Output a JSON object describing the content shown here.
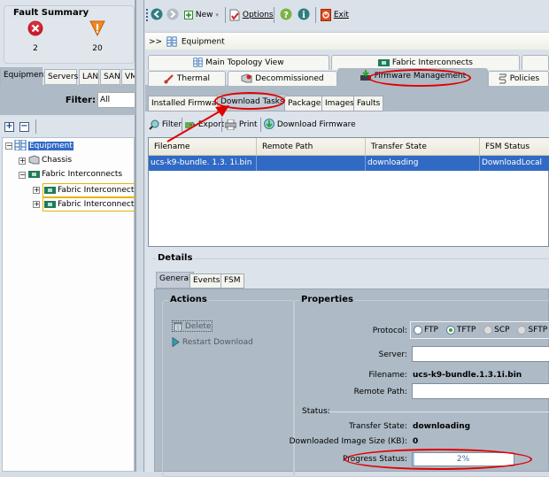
{
  "fault_summary": {
    "title": "Fault Summary",
    "critical": {
      "icon": "critical-x-icon",
      "count": "2",
      "color": "#cc1f2c"
    },
    "major": {
      "icon": "warning-triangle-icon",
      "count": "20",
      "color": "#f07a1a"
    }
  },
  "left_tabs": [
    {
      "label": "Equipment",
      "active": true
    },
    {
      "label": "Servers"
    },
    {
      "label": "LAN"
    },
    {
      "label": "SAN"
    },
    {
      "label": "VM"
    }
  ],
  "filter": {
    "label": "Filter:",
    "value": "All"
  },
  "tree": {
    "expand_all": "+",
    "collapse_all": "−",
    "nodes": [
      {
        "label": "Equipment",
        "selected": true,
        "icon": "equipment-icon"
      },
      {
        "label": "Chassis",
        "icon": "chassis-icon"
      },
      {
        "label": "Fabric Interconnects",
        "icon": "fabric-interconnect-icon"
      },
      {
        "label": "Fabric Interconnect A (",
        "icon": "fabric-interconnect-icon"
      },
      {
        "label": "Fabric Interconnect B (",
        "icon": "fabric-interconnect-icon"
      }
    ]
  },
  "toolbar": {
    "back": "back-icon",
    "forward": "forward-icon",
    "new_label": "New",
    "options_label": "Options",
    "help": "help-icon",
    "info": "info-icon",
    "exit_label": "Exit"
  },
  "breadcrumb": {
    "prefix": ">>",
    "label": "Equipment"
  },
  "top_tabs_row1": [
    {
      "label": "Main Topology View"
    },
    {
      "label": "Fabric Interconnects"
    },
    {
      "label": ""
    }
  ],
  "top_tabs_row2": [
    {
      "label": "Thermal"
    },
    {
      "label": "Decommissioned"
    },
    {
      "label": "Firmware Management",
      "active": true
    },
    {
      "label": "Policies"
    }
  ],
  "sub_tabs": [
    {
      "label": "Installed Firmware"
    },
    {
      "label": "Download Tasks",
      "active": true
    },
    {
      "label": "Packages"
    },
    {
      "label": "Images"
    },
    {
      "label": "Faults"
    }
  ],
  "grid_tools": [
    {
      "label": "Filter",
      "icon": "filter-icon"
    },
    {
      "label": "Export",
      "icon": "export-icon"
    },
    {
      "label": "Print",
      "icon": "print-icon"
    },
    {
      "label": "Download Firmware",
      "icon": "download-firmware-icon"
    }
  ],
  "table": {
    "columns": [
      "Filename",
      "Remote Path",
      "Transfer State",
      "FSM Status"
    ],
    "rows": [
      [
        "ucs-k9-bundle. 1.3. 1i.bin",
        "",
        "downloading",
        "DownloadLocal"
      ]
    ]
  },
  "details": {
    "title": "Details",
    "tabs": [
      {
        "label": "General",
        "active": true
      },
      {
        "label": "Events"
      },
      {
        "label": "FSM"
      }
    ],
    "actions": {
      "title": "Actions",
      "items": [
        {
          "label": "Delete",
          "icon": "trash-icon"
        },
        {
          "label": "Restart Download",
          "icon": "play-icon"
        }
      ]
    },
    "properties": {
      "title": "Properties",
      "protocol_label": "Protocol:",
      "protocols": [
        {
          "label": "FTP",
          "selected": false
        },
        {
          "label": "TFTP",
          "selected": true
        },
        {
          "label": "SCP",
          "selected": false
        },
        {
          "label": "SFTP",
          "selected": false
        }
      ],
      "server_label": "Server:",
      "server_value": "",
      "filename_label": "Filename:",
      "filename_value": "ucs-k9-bundle.1.3.1i.bin",
      "remote_path_label": "Remote Path:",
      "remote_path_value": "",
      "status_label": "Status:",
      "transfer_state_label": "Transfer State:",
      "transfer_state_value": "downloading",
      "image_size_label": "Downloaded Image Size (KB):",
      "image_size_value": "0",
      "progress_label": "Progress Status:",
      "progress_value": "2%",
      "progress_fraction": 0.02
    }
  },
  "annotation_color": "#e00000"
}
